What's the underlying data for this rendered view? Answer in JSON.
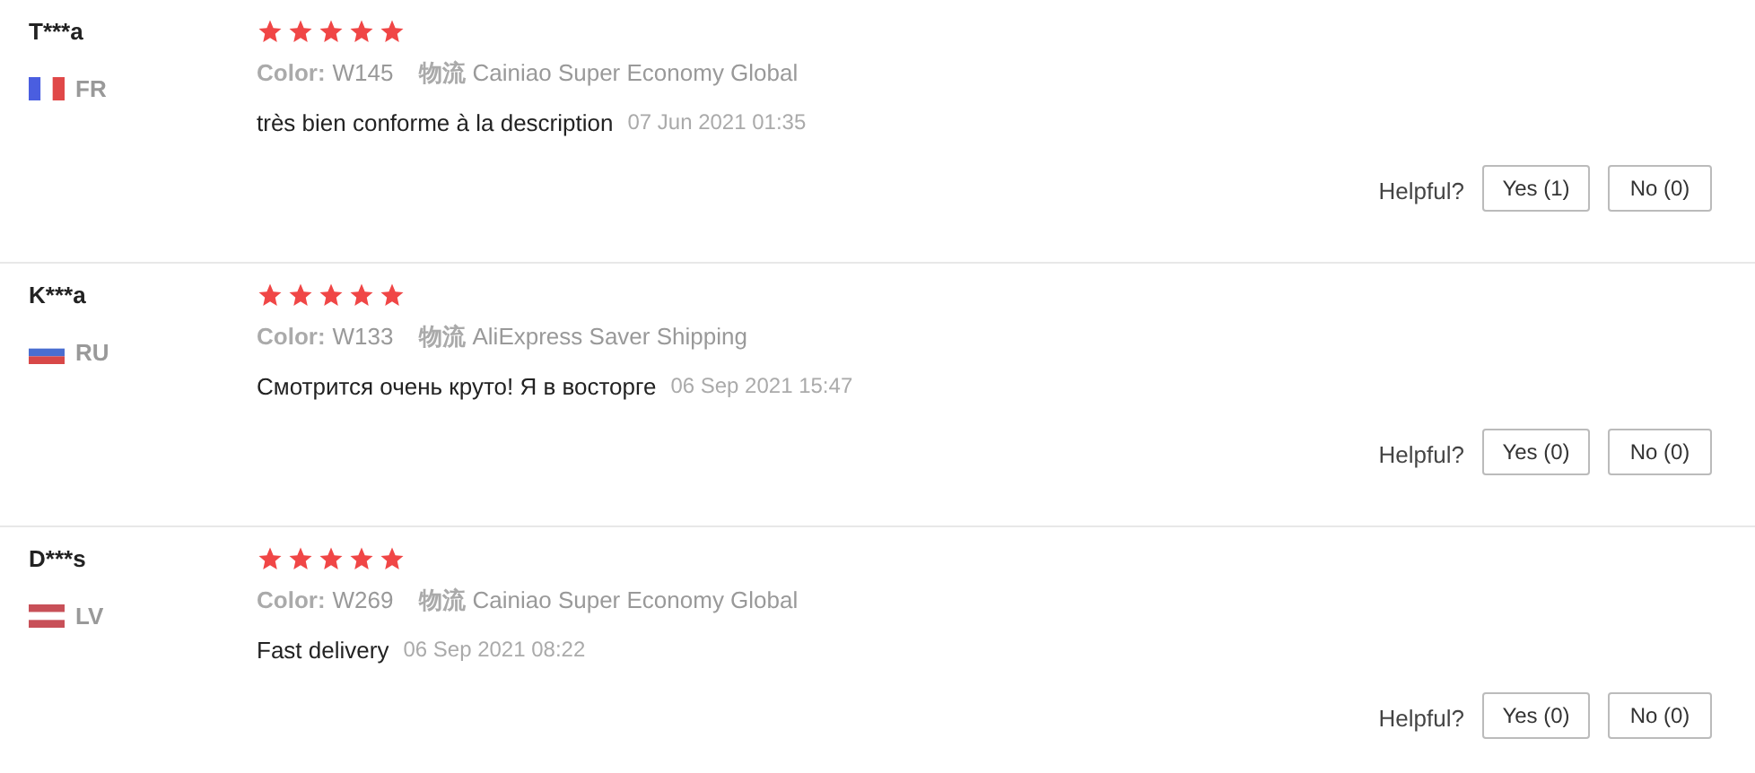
{
  "reviews": [
    {
      "name": "T***a",
      "kind": "fr",
      "country": "FR",
      "stars": 5,
      "color_label": "Color:",
      "color_value": "W145",
      "shipping_label": "物流",
      "shipping_value": "Cainiao Super Economy Global",
      "text": "très bien conforme à la description",
      "date": "07 Jun 2021 01:35",
      "helpful_label": "Helpful?",
      "yes": "Yes (1)",
      "no": "No (0)"
    },
    {
      "name": "K***a",
      "kind": "ru",
      "country": "RU",
      "stars": 5,
      "color_label": "Color:",
      "color_value": "W133",
      "shipping_label": "物流",
      "shipping_value": "AliExpress Saver Shipping",
      "text": "Смотрится очень круто! Я в восторге",
      "date": "06 Sep 2021 15:47",
      "helpful_label": "Helpful?",
      "yes": "Yes (0)",
      "no": "No (0)"
    },
    {
      "name": "D***s",
      "kind": "lv",
      "country": "LV",
      "stars": 5,
      "color_label": "Color:",
      "color_value": "W269",
      "shipping_label": "物流",
      "shipping_value": "Cainiao Super Economy Global",
      "text": "Fast delivery",
      "date": "06 Sep 2021 08:22",
      "helpful_label": "Helpful?",
      "yes": "Yes (0)",
      "no": "No (0)"
    }
  ]
}
